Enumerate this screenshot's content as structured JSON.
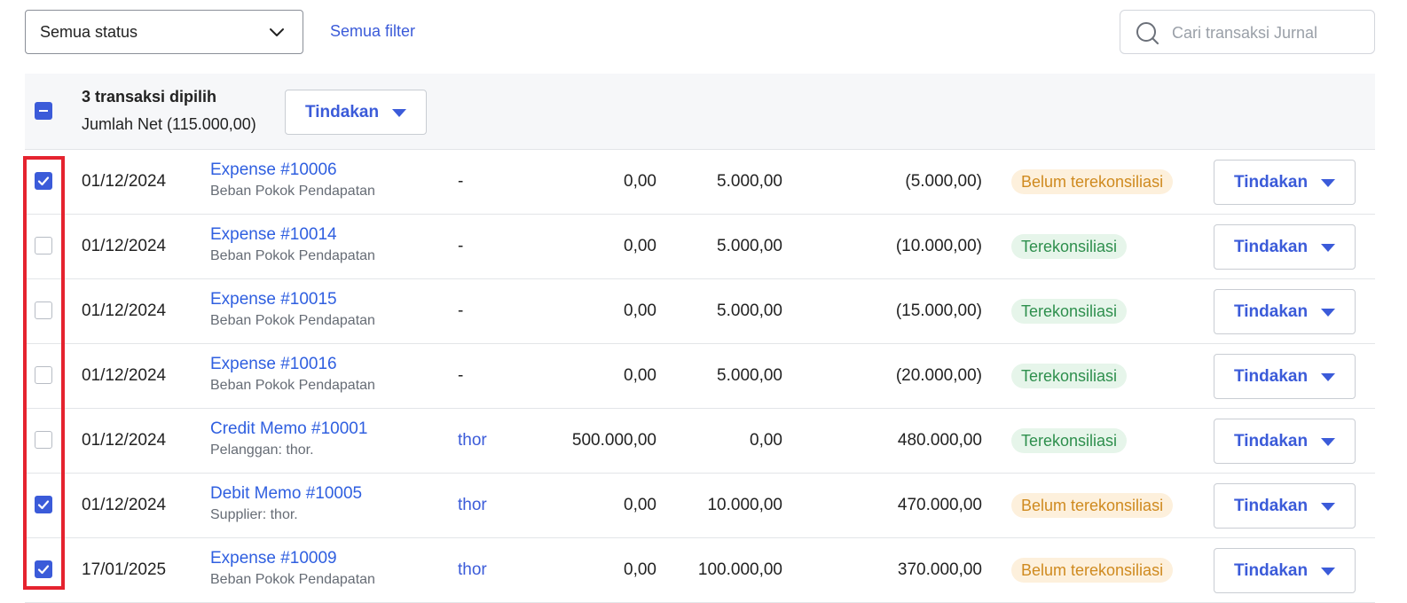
{
  "toolbar": {
    "status_select": "Semua status",
    "filter_link": "Semua filter",
    "search_placeholder": "Cari transaksi Jurnal"
  },
  "selection": {
    "count_label": "3 transaksi dipilih",
    "net_label": "Jumlah Net (115.000,00)",
    "action_label": "Tindakan"
  },
  "rows": [
    {
      "checked": true,
      "date": "01/12/2024",
      "title": "Expense #10006",
      "subtitle": "Beban Pokok Pendapatan",
      "contact": "-",
      "debit": "0,00",
      "credit": "5.000,00",
      "balance": "(5.000,00)",
      "status": "Belum terekonsiliasi",
      "action": "Tindakan"
    },
    {
      "checked": false,
      "date": "01/12/2024",
      "title": "Expense #10014",
      "subtitle": "Beban Pokok Pendapatan",
      "contact": "-",
      "debit": "0,00",
      "credit": "5.000,00",
      "balance": "(10.000,00)",
      "status": "Terekonsiliasi",
      "action": "Tindakan"
    },
    {
      "checked": false,
      "date": "01/12/2024",
      "title": "Expense #10015",
      "subtitle": "Beban Pokok Pendapatan",
      "contact": "-",
      "debit": "0,00",
      "credit": "5.000,00",
      "balance": "(15.000,00)",
      "status": "Terekonsiliasi",
      "action": "Tindakan"
    },
    {
      "checked": false,
      "date": "01/12/2024",
      "title": "Expense #10016",
      "subtitle": "Beban Pokok Pendapatan",
      "contact": "-",
      "debit": "0,00",
      "credit": "5.000,00",
      "balance": "(20.000,00)",
      "status": "Terekonsiliasi",
      "action": "Tindakan"
    },
    {
      "checked": false,
      "date": "01/12/2024",
      "title": "Credit Memo #10001",
      "subtitle": "Pelanggan: thor.",
      "contact": "thor",
      "debit": "500.000,00",
      "credit": "0,00",
      "balance": "480.000,00",
      "status": "Terekonsiliasi",
      "action": "Tindakan"
    },
    {
      "checked": true,
      "date": "01/12/2024",
      "title": "Debit Memo #10005",
      "subtitle": "Supplier: thor.",
      "contact": "thor",
      "debit": "0,00",
      "credit": "10.000,00",
      "balance": "470.000,00",
      "status": "Belum terekonsiliasi",
      "action": "Tindakan"
    },
    {
      "checked": true,
      "date": "17/01/2025",
      "title": "Expense #10009",
      "subtitle": "Beban Pokok Pendapatan",
      "contact": "thor",
      "debit": "0,00",
      "credit": "100.000,00",
      "balance": "370.000,00",
      "status": "Belum terekonsiliasi",
      "action": "Tindakan"
    }
  ],
  "colors": {
    "accent": "#3b5bd9",
    "link": "#2f5fe0",
    "unreconciled_bg": "#fdf0dc",
    "unreconciled_text": "#cf8a1f",
    "reconciled_bg": "#e6f5ea",
    "reconciled_text": "#2e8f4d",
    "highlight": "#e5232f"
  },
  "icons": {
    "status_dropdown": "chevron-down-icon",
    "search": "search-icon",
    "action_caret": "caret-down-icon",
    "checkbox_check": "check-icon"
  }
}
